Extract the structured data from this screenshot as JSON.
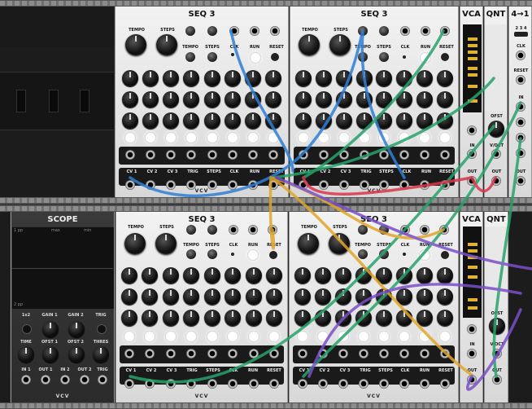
{
  "rows": [
    {
      "modules": [
        {
          "title": "SEQ 3",
          "labels": {
            "tempo": "TEMPO",
            "steps": "STEPS",
            "tempo_sm": "TEMPO",
            "steps_sm": "STEPS",
            "clk": "CLK",
            "run": "RUN",
            "reset": "RESET"
          },
          "outs": [
            "CV 1",
            "CV 2",
            "CV 3",
            "TRIG",
            "STEPS",
            "CLK",
            "RUN",
            "RESET"
          ],
          "brand": "VCV"
        },
        {
          "title": "SEQ 3",
          "labels": {
            "tempo": "TEMPO",
            "steps": "STEPS",
            "tempo_sm": "TEMPO",
            "steps_sm": "STEPS",
            "clk": "CLK",
            "run": "RUN",
            "reset": "RESET"
          },
          "outs": [
            "CV 1",
            "CV 2",
            "CV 3",
            "TRIG",
            "STEPS",
            "CLK",
            "RUN",
            "RESET"
          ],
          "brand": "VCV"
        },
        {
          "title": "VCA",
          "labels": {
            "in": "IN",
            "out": "OUT"
          }
        },
        {
          "title": "QNT",
          "labels": {
            "ofst": "OFST",
            "voct": "V/OCT",
            "out": "OUT"
          }
        },
        {
          "title": "4→1",
          "labels": {
            "nums": "2 3 4",
            "clk": "CLK",
            "reset": "RESET",
            "in": "IN",
            "out": "OUT"
          }
        }
      ]
    },
    {
      "modules": [
        {
          "title": "SCOPE",
          "labels": {
            "x2": "1x2",
            "gain1": "GAIN 1",
            "gain2": "GAIN 2",
            "trig": "TRIG",
            "time": "TIME",
            "ofst1": "OFST 1",
            "ofst2": "OFST 2",
            "thres": "THRES",
            "in1": "IN 1",
            "out1": "OUT 1",
            "in2": "IN 2",
            "out2": "OUT 2",
            "trig2": "TRIG"
          },
          "screen": {
            "t1": "1 pp",
            "t2": "max",
            "t3": "min",
            "t4": "2 pp"
          },
          "brand": "VCV"
        },
        {
          "title": "SEQ 3",
          "labels": {
            "tempo": "TEMPO",
            "steps": "STEPS",
            "tempo_sm": "TEMPO",
            "steps_sm": "STEPS",
            "clk": "CLK",
            "run": "RUN",
            "reset": "RESET"
          },
          "outs": [
            "CV 1",
            "CV 2",
            "CV 3",
            "TRIG",
            "STEPS",
            "CLK",
            "RUN",
            "RESET"
          ],
          "brand": "VCV"
        },
        {
          "title": "SEQ 3",
          "labels": {
            "tempo": "TEMPO",
            "steps": "STEPS",
            "tempo_sm": "TEMPO",
            "steps_sm": "STEPS",
            "clk": "CLK",
            "run": "RUN",
            "reset": "RESET"
          },
          "outs": [
            "CV 1",
            "CV 2",
            "CV 3",
            "TRIG",
            "STEPS",
            "CLK",
            "RUN",
            "RESET"
          ],
          "brand": "VCV"
        },
        {
          "title": "VCA",
          "labels": {
            "in": "IN",
            "out": "OUT"
          }
        },
        {
          "title": "QNT",
          "labels": {
            "ofst": "OFST",
            "voct": "V/OCT",
            "out": "OUT"
          }
        }
      ]
    }
  ],
  "cable_colors": {
    "blue": "#2f7fd6",
    "green": "#27a36b",
    "yellow": "#e0a62a",
    "purple": "#7b4fc9",
    "red": "#d9364a"
  }
}
